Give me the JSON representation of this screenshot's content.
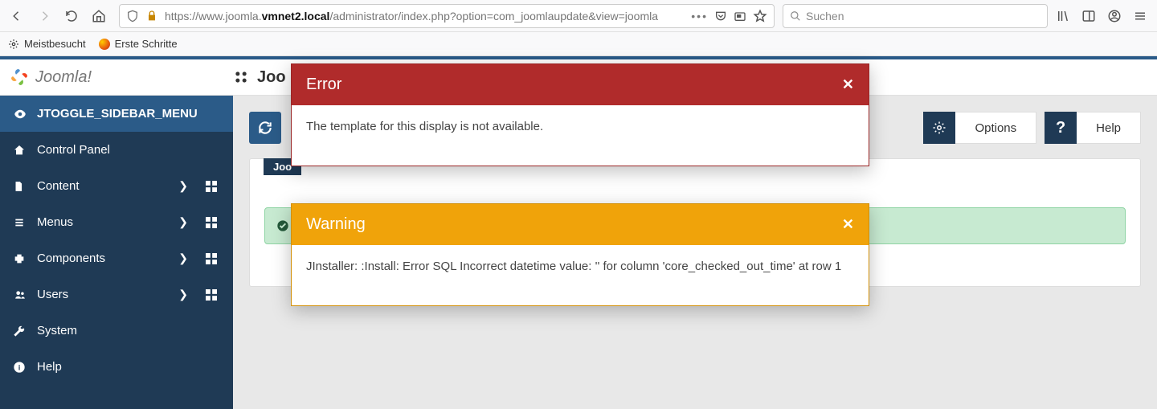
{
  "browser": {
    "url_prefix": "https://www.joomla.",
    "url_host": "vmnet2.local",
    "url_path": "/administrator/index.php?option=com_joomlaupdate&view=joomla",
    "search_placeholder": "Suchen"
  },
  "bookmarks": {
    "most_visited": "Meistbesucht",
    "first_steps": "Erste Schritte"
  },
  "brand": "Joomla!",
  "page_title_prefix": "Joo",
  "sidebar": {
    "toggle": "JTOGGLE_SIDEBAR_MENU",
    "items": [
      {
        "label": "Control Panel",
        "icon": "home",
        "submenu": false
      },
      {
        "label": "Content",
        "icon": "file",
        "submenu": true
      },
      {
        "label": "Menus",
        "icon": "list",
        "submenu": true
      },
      {
        "label": "Components",
        "icon": "puzzle",
        "submenu": true
      },
      {
        "label": "Users",
        "icon": "users",
        "submenu": true
      },
      {
        "label": "System",
        "icon": "wrench",
        "submenu": false
      },
      {
        "label": "Help",
        "icon": "info",
        "submenu": false
      }
    ]
  },
  "toolbar": {
    "options_label": "Options",
    "help_label": "Help"
  },
  "panel": {
    "tab_label": "Joo"
  },
  "modals": {
    "error": {
      "title": "Error",
      "body": "The template for this display is not available."
    },
    "warning": {
      "title": "Warning",
      "body": "JInstaller: :Install: Error SQL Incorrect datetime value: '' for column 'core_checked_out_time' at row 1"
    }
  }
}
